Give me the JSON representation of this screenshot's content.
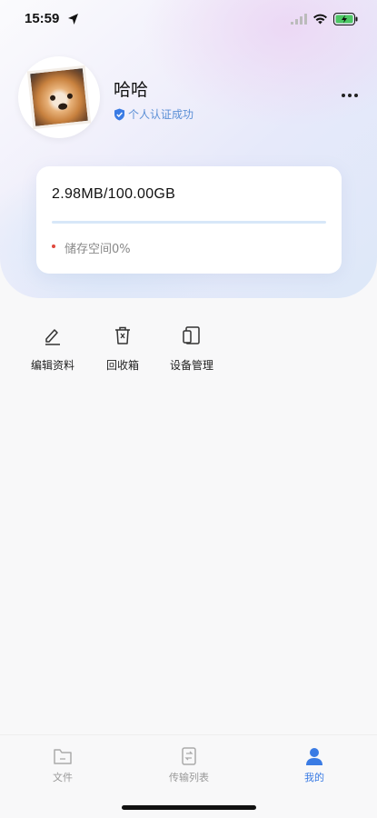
{
  "status_bar": {
    "time": "15:59"
  },
  "profile": {
    "name": "哈哈",
    "verify_text": "个人认证成功"
  },
  "storage": {
    "amount": "2.98MB/100.00GB",
    "usage_label": "储存空间0%",
    "usage_fraction": 0.0
  },
  "actions": [
    {
      "label": "编辑资料",
      "icon": "edit-icon"
    },
    {
      "label": "回收箱",
      "icon": "trash-icon"
    },
    {
      "label": "设备管理",
      "icon": "devices-icon"
    }
  ],
  "tabbar": {
    "tabs": [
      {
        "label": "文件",
        "icon": "folder-icon",
        "active": false
      },
      {
        "label": "传输列表",
        "icon": "transfer-icon",
        "active": false
      },
      {
        "label": "我的",
        "icon": "user-icon",
        "active": true
      }
    ]
  },
  "colors": {
    "accent": "#3a7be4",
    "verify": "#5b8fd6",
    "dot": "#e0483c"
  }
}
